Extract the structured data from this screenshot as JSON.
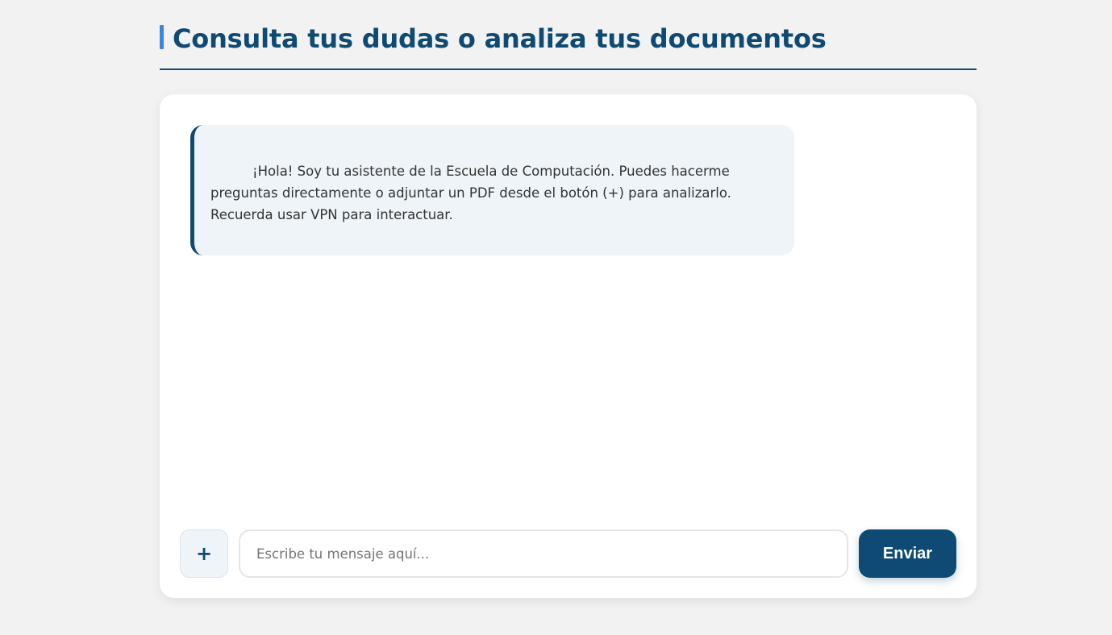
{
  "header": {
    "title": "Consulta tus dudas o analiza tus documentos"
  },
  "chat": {
    "messages": [
      {
        "role": "bot",
        "text": "¡Hola! Soy tu asistente de la Escuela de Computación. Puedes hacerme preguntas directamente o adjuntar un PDF desde el botón (+) para analizarlo. Recuerda usar VPN para interactuar."
      }
    ]
  },
  "composer": {
    "attach_label": "+",
    "input_value": "",
    "input_placeholder": "Escribe tu mensaje aquí...",
    "send_label": "Enviar"
  },
  "colors": {
    "primary": "#0e4a73",
    "accent": "#3d86e0",
    "background": "#f2f2f2",
    "bubble": "#eff4f8"
  }
}
